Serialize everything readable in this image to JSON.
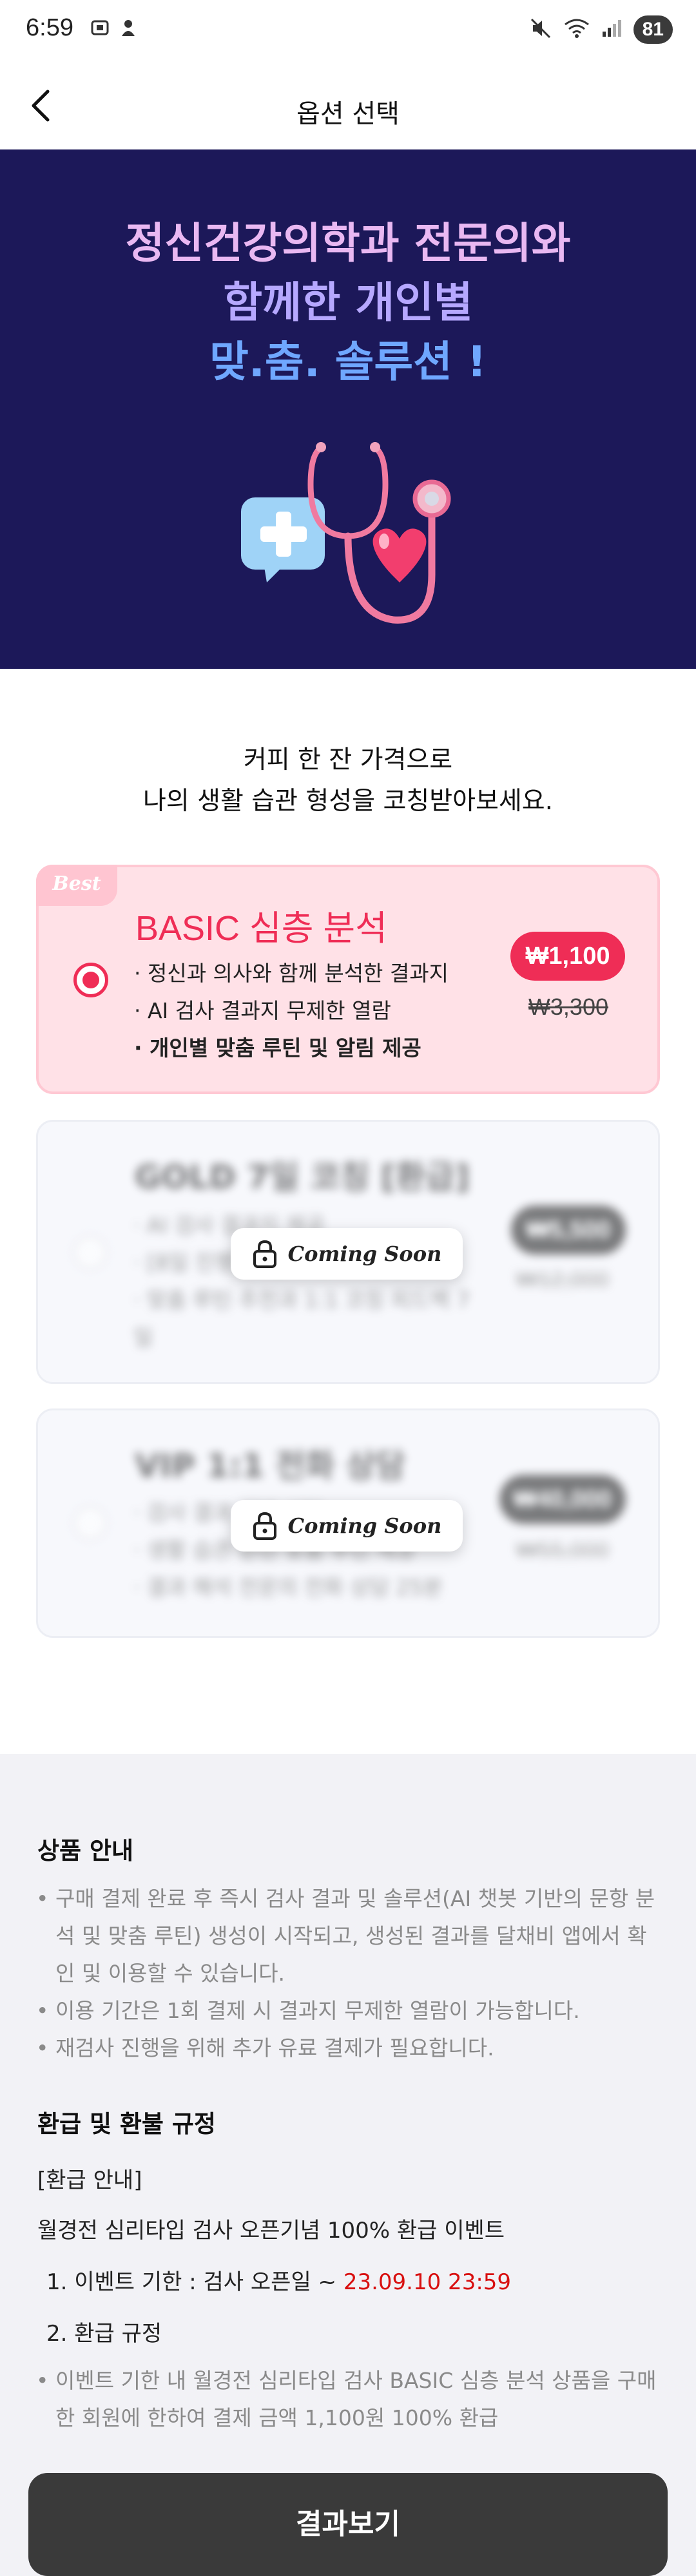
{
  "status_bar": {
    "time": "6:59",
    "battery": "81"
  },
  "header": {
    "title": "옵션 선택"
  },
  "hero": {
    "line1": "정신건강의학과 전문의와",
    "line2": "함께한 개인별",
    "line3": "맞.춤. 솔루션 !"
  },
  "intro": {
    "line1": "커피 한 잔 가격으로",
    "line2": "나의 생활 습관 형성을 코칭받아보세요."
  },
  "options": [
    {
      "badge": "Best",
      "title": "BASIC 심층 분석",
      "features": [
        "· 정신과 의사와 함께 분석한 결과지",
        "· AI 검사 결과지 무제한 열람",
        "· 개인별 맞춤 루틴 및 알림 제공"
      ],
      "price": "₩1,100",
      "original_price": "₩3,300",
      "selected": true
    },
    {
      "title": "GOLD 7일 코칭 [환급]",
      "features": [
        "· AI 검사 결과지 제공",
        "· [8일 진행] 맞춤 루틴 및 알림",
        "· 맞춤 루틴 추천과 1:1 코칭 피드백 7",
        "일"
      ],
      "price": "₩5,500",
      "original_price": "₩12,000",
      "coming_soon": "Coming Soon",
      "selected": false
    },
    {
      "title": "VIP 1:1 전화 상담",
      "features": [
        "· 검사 결과 기반 상담",
        "· 생활 습관 관련 맞춤 루틴 제공",
        "· 결과 해석 전문의 전화 상담 25분"
      ],
      "price": "₩40,000",
      "original_price": "₩55,000",
      "coming_soon": "Coming Soon",
      "selected": false
    }
  ],
  "product_info": {
    "heading": "상품 안내",
    "bullets": [
      "구매 결제 완료 후 즉시 검사 결과 및 솔루션(AI 챗봇 기반의 문항 분석 및 맞춤 루틴) 생성이 시작되고, 생성된 결과를 달채비 앱에서 확인 및 이용할 수 있습니다.",
      "이용 기간은 1회 결제 시 결과지 무제한 열람이 가능합니다.",
      "재검사 진행을 위해 추가 유료 결제가 필요합니다."
    ]
  },
  "refund": {
    "heading": "환급 및 환불 규정",
    "sub_heading": "[환급 안내]",
    "event": "월경전 심리타입 검사 오픈기념 100% 환급 이벤트",
    "item1_label": "1. 이벤트 기한 : 검사 오픈일 ~ ",
    "item1_date": "23.09.10 23:59",
    "item2_label": "2. 환급 규정",
    "bullet": "이벤트 기한 내 월경전 심리타입 검사 BASIC 심층 분석 상품을 구매한 회원에 한하여 결제 금액 1,100원 100% 환급"
  },
  "cta": {
    "label": "결과보기"
  },
  "colors": {
    "hero_bg": "#1c1859",
    "accent": "#ef2d56",
    "cta_bg": "#3a3a3a"
  }
}
